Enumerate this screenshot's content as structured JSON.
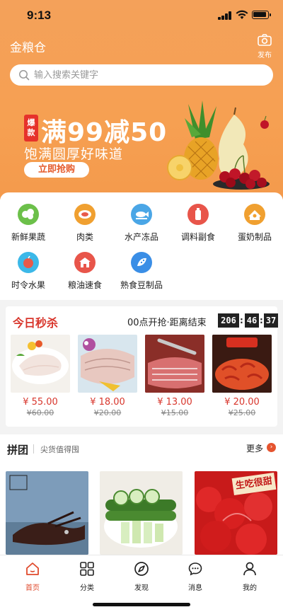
{
  "status_bar": {
    "time": "9:13"
  },
  "header": {
    "app_title": "金粮仓",
    "publish_label": "发布"
  },
  "search": {
    "placeholder": "输入搜索关键字"
  },
  "banner": {
    "badge": "爆款",
    "headline": "满99减50",
    "subline": "饱满圆厚好味道",
    "button": "立即抢购"
  },
  "categories": [
    {
      "label": "新鲜果蔬",
      "icon": "vegetable-icon",
      "color": "#6cc04a"
    },
    {
      "label": "肉类",
      "icon": "meat-icon",
      "color": "#f0a030"
    },
    {
      "label": "水产冻品",
      "icon": "fish-icon",
      "color": "#4aa6e6"
    },
    {
      "label": "调料副食",
      "icon": "seasoning-icon",
      "color": "#e8554a"
    },
    {
      "label": "蛋奶制品",
      "icon": "egg-icon",
      "color": "#f0a030"
    },
    {
      "label": "时令水果",
      "icon": "fruit-icon",
      "color": "#3cb8e8"
    },
    {
      "label": "粮油速食",
      "icon": "grain-oil-icon",
      "color": "#e8554a"
    },
    {
      "label": "熟食豆制品",
      "icon": "deli-icon",
      "color": "#3a8ee6"
    }
  ],
  "flash_sale": {
    "title": "今日秒杀",
    "countdown_label": "00点开抢·距离结束",
    "hours": "206",
    "minutes": "46",
    "seconds": "37",
    "items": [
      {
        "price": "¥ 55.00",
        "old_price": "¥60.00"
      },
      {
        "price": "¥ 18.00",
        "old_price": "¥20.00"
      },
      {
        "price": "¥ 13.00",
        "old_price": "¥15.00"
      },
      {
        "price": "¥ 20.00",
        "old_price": "¥25.00"
      }
    ]
  },
  "group_buy": {
    "title": "拼团",
    "subtitle": "尖货值得囤",
    "more_label": "更多",
    "item_tags": [
      "",
      "",
      "生吃很甜"
    ]
  },
  "tabbar": [
    {
      "label": "首页",
      "icon": "home-icon",
      "active": true
    },
    {
      "label": "分类",
      "icon": "category-icon",
      "active": false
    },
    {
      "label": "发现",
      "icon": "discover-icon",
      "active": false
    },
    {
      "label": "消息",
      "icon": "message-icon",
      "active": false
    },
    {
      "label": "我的",
      "icon": "profile-icon",
      "active": false
    }
  ],
  "colors": {
    "theme_orange": "#f5a055",
    "accent_red": "#d8362c",
    "active_tab": "#e04a2c"
  }
}
